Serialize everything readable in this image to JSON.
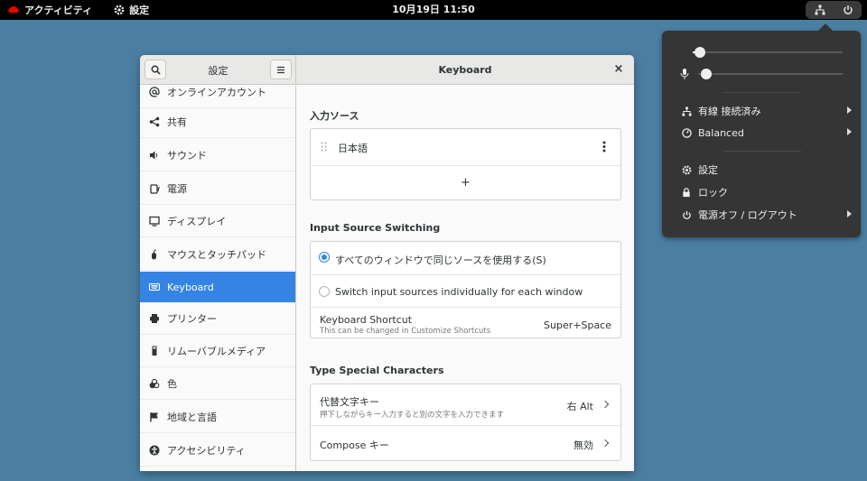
{
  "topbar": {
    "activities_label": "アクティビティ",
    "app_label": "設定",
    "clock": "10月19日  11:50"
  },
  "system_menu": {
    "volume_level": 0.05,
    "mic_level": 0.02,
    "items": [
      {
        "label": "有線 接続済み",
        "icon": "network-wired-icon",
        "submenu": true
      },
      {
        "label": "Balanced",
        "icon": "power-profile-icon",
        "submenu": true
      },
      {
        "label": "設定",
        "icon": "gear-icon",
        "submenu": false
      },
      {
        "label": "ロック",
        "icon": "lock-icon",
        "submenu": false
      },
      {
        "label": "電源オフ / ログアウト",
        "icon": "power-icon",
        "submenu": true
      }
    ]
  },
  "window": {
    "sidebar_title": "設定",
    "main_title": "Keyboard",
    "sidebar_items": [
      {
        "label": "オンラインアカウント",
        "icon": "at-icon"
      },
      {
        "label": "共有",
        "icon": "share-icon"
      },
      {
        "label": "サウンド",
        "icon": "speaker-icon"
      },
      {
        "label": "電源",
        "icon": "battery-icon"
      },
      {
        "label": "ディスプレイ",
        "icon": "display-icon"
      },
      {
        "label": "マウスとタッチパッド",
        "icon": "mouse-icon"
      },
      {
        "label": "Keyboard",
        "icon": "keyboard-icon",
        "active": true
      },
      {
        "label": "プリンター",
        "icon": "printer-icon"
      },
      {
        "label": "リムーバブルメディア",
        "icon": "usb-icon"
      },
      {
        "label": "色",
        "icon": "color-icon"
      },
      {
        "label": "地域と言語",
        "icon": "flag-icon"
      },
      {
        "label": "アクセシビリティ",
        "icon": "accessibility-icon"
      }
    ]
  },
  "keyboard": {
    "input_sources_title": "入力ソース",
    "input_source": "日本語",
    "add_label": "+",
    "switching_title": "Input Source Switching",
    "option_same": "すべてのウィンドウで同じソースを使用する(S)",
    "option_individual": "Switch input sources individually for each window",
    "shortcut_label": "Keyboard Shortcut",
    "shortcut_hint": "This can be changed in Customize Shortcuts",
    "shortcut_value": "Super+Space",
    "special_title": "Type Special Characters",
    "alt_key_label": "代替文字キー",
    "alt_key_hint": "押下しながらキー入力すると別の文字を入力できます",
    "alt_key_value": "右 Alt",
    "compose_label": "Compose キー",
    "compose_value": "無効"
  }
}
